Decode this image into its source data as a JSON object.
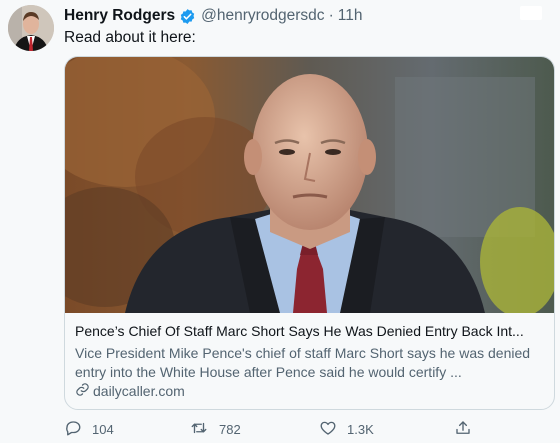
{
  "tweet": {
    "author_name": "Henry Rodgers",
    "handle": "@henryrodgersdc",
    "separator": "·",
    "time": "11h",
    "text": "Read about it here:"
  },
  "card": {
    "title": "Pence’s Chief Of Staff Marc Short Says He Was Denied Entry Back Int...",
    "description": "Vice President Mike Pence's chief of staff Marc Short says he was denied entry into the White House after Pence said he would certify ...",
    "domain": "dailycaller.com",
    "link_icon": "link-icon"
  },
  "actions": {
    "reply_count": "104",
    "retweet_count": "782",
    "like_count": "1.3K",
    "icons": [
      "reply-icon",
      "retweet-icon",
      "like-icon",
      "share-icon"
    ]
  },
  "colors": {
    "verified": "#1d9bf0",
    "secondary_text": "#536471",
    "border": "#cfd9de",
    "background": "#f7f9fa"
  }
}
